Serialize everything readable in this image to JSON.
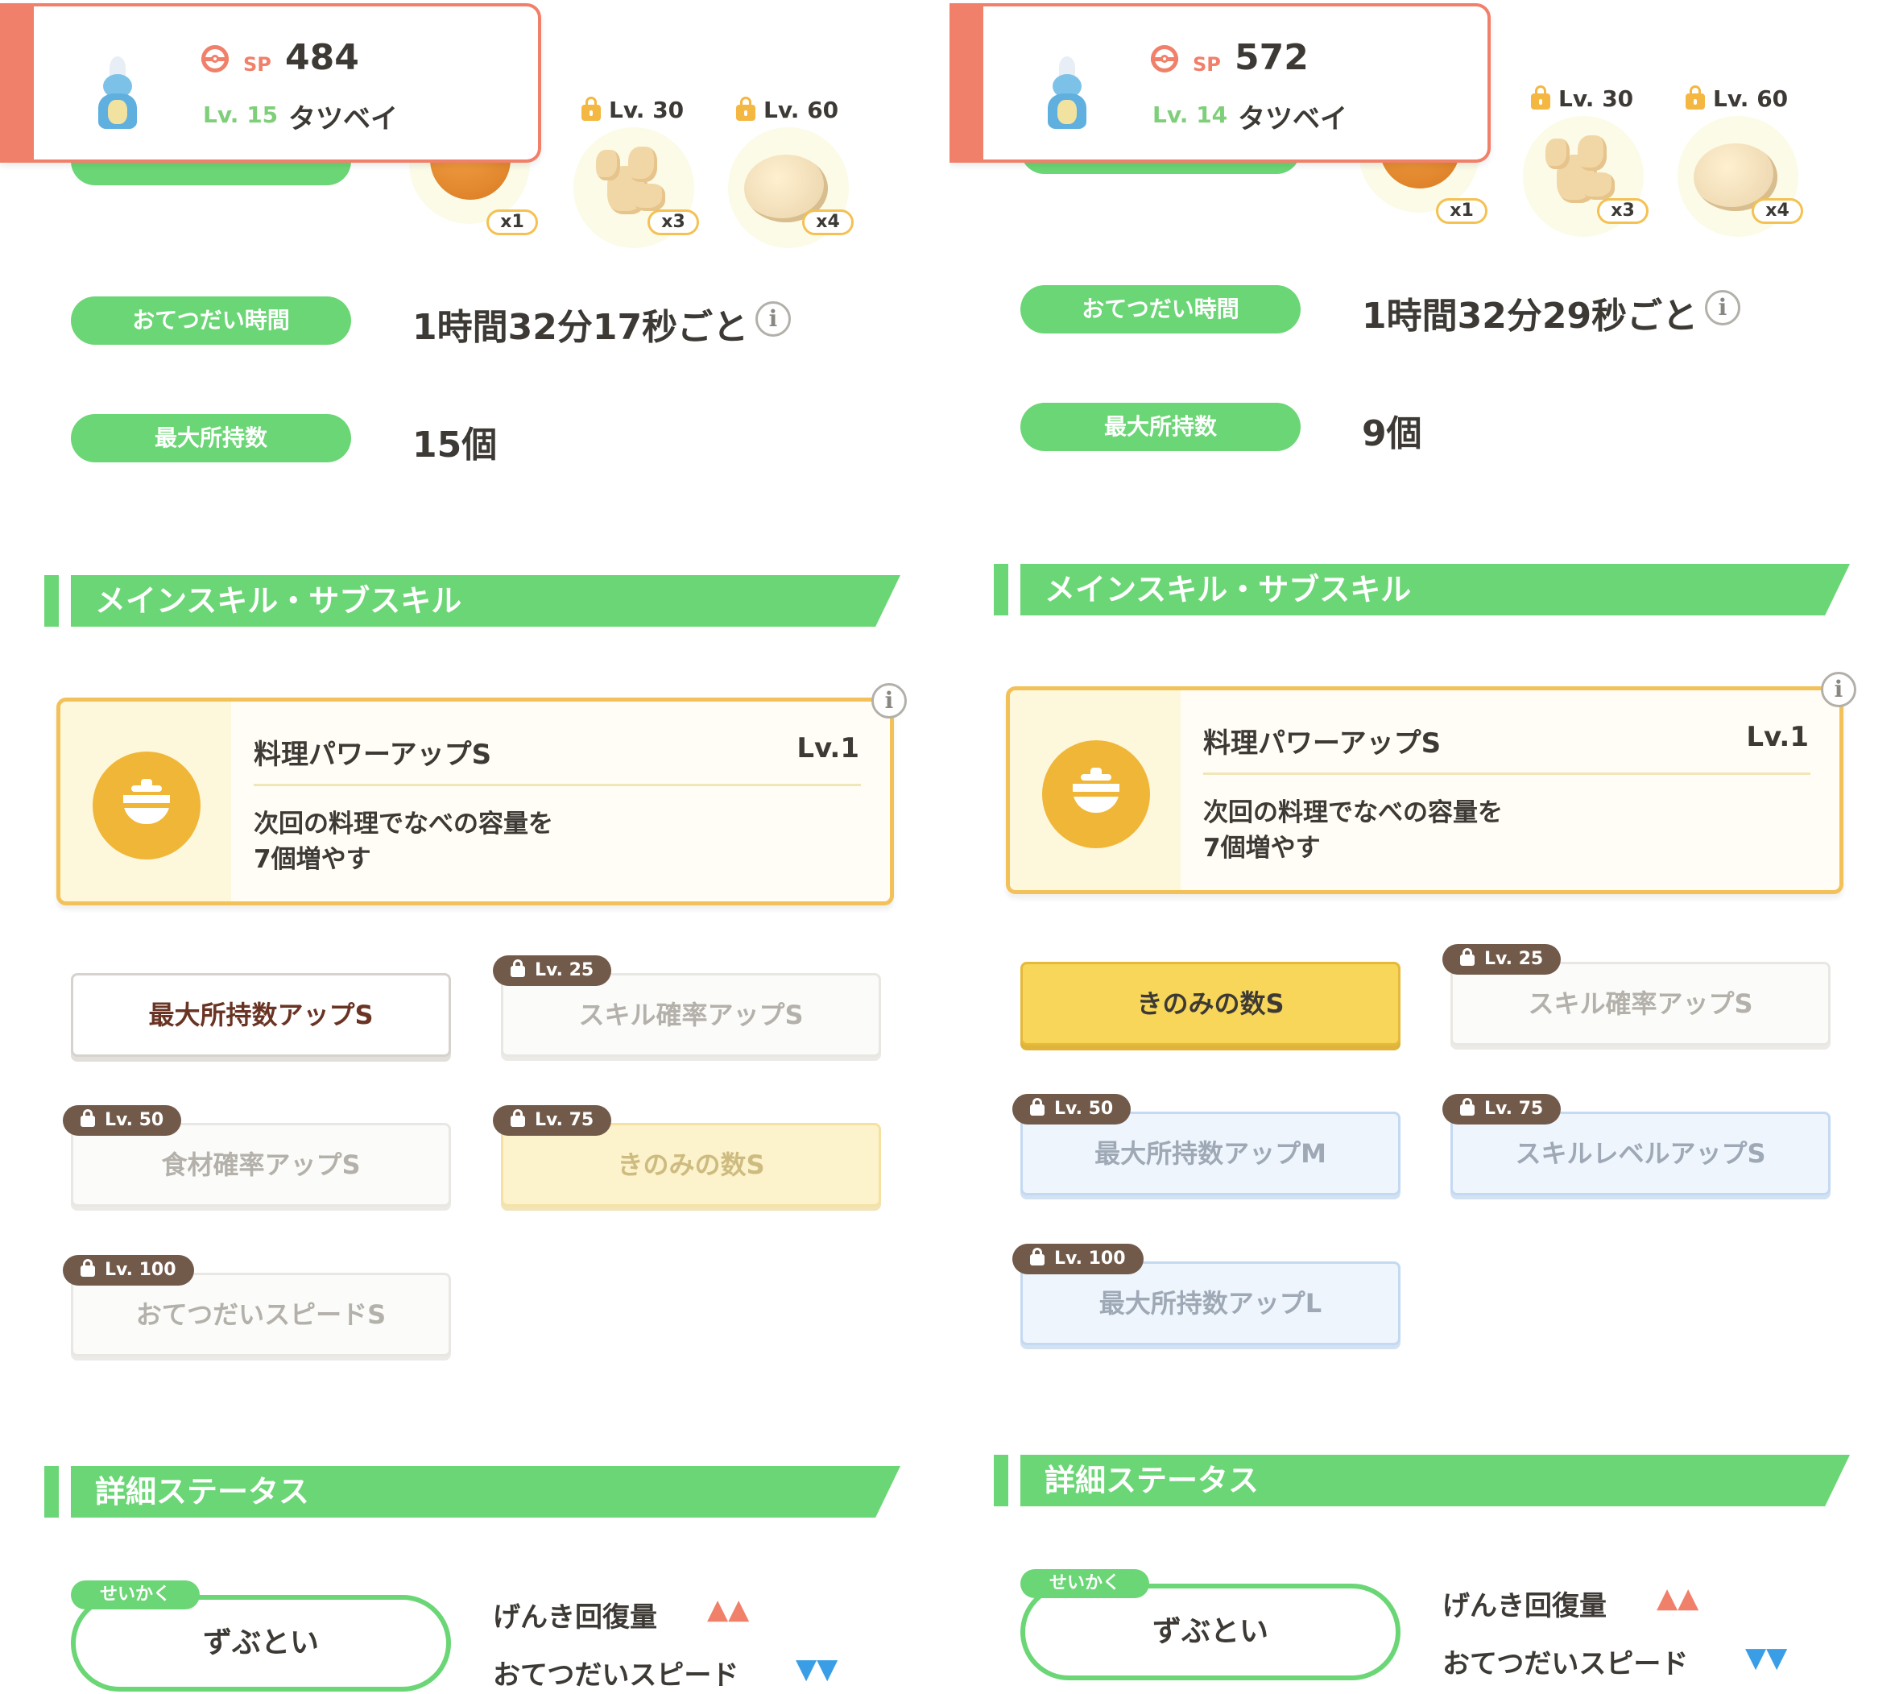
{
  "panels": [
    {
      "sp_label": "SP",
      "sp_value": "484",
      "level": "Lv. 15",
      "name": "タツベイ",
      "ingredients": [
        {
          "count": "x1",
          "level": ""
        },
        {
          "count": "x3",
          "level": "Lv. 30"
        },
        {
          "count": "x4",
          "level": "Lv. 60"
        }
      ],
      "help_time_label": "おてつだい時間",
      "help_time_value": "1時間32分17秒ごと",
      "max_carry_label": "最大所持数",
      "max_carry_value": "15個",
      "skills_header": "メインスキル・サブスキル",
      "main_skill": {
        "name": "料理パワーアップS",
        "level": "Lv.1",
        "desc_line1": "次回の料理でなべの容量を",
        "desc_line2": "7個増やす"
      },
      "sub_skills": [
        {
          "label": "最大所持数アップS",
          "lock": ""
        },
        {
          "label": "スキル確率アップS",
          "lock": "Lv. 25"
        },
        {
          "label": "食材確率アップS",
          "lock": "Lv. 50"
        },
        {
          "label": "きのみの数S",
          "lock": "Lv. 75"
        },
        {
          "label": "おてつだいスピードS",
          "lock": "Lv. 100"
        }
      ],
      "status_header": "詳細ステータス",
      "nature_tag": "せいかく",
      "nature": "ずぶとい",
      "stat_up": "げんき回復量",
      "stat_up_marks": "▲▲",
      "stat_down": "おてつだいスピード",
      "stat_down_marks": "▼▼"
    },
    {
      "sp_label": "SP",
      "sp_value": "572",
      "level": "Lv. 14",
      "name": "タツベイ",
      "ingredients": [
        {
          "count": "x1",
          "level": ""
        },
        {
          "count": "x3",
          "level": "Lv. 30"
        },
        {
          "count": "x4",
          "level": "Lv. 60"
        }
      ],
      "help_time_label": "おてつだい時間",
      "help_time_value": "1時間32分29秒ごと",
      "max_carry_label": "最大所持数",
      "max_carry_value": "9個",
      "skills_header": "メインスキル・サブスキル",
      "main_skill": {
        "name": "料理パワーアップS",
        "level": "Lv.1",
        "desc_line1": "次回の料理でなべの容量を",
        "desc_line2": "7個増やす"
      },
      "sub_skills": [
        {
          "label": "きのみの数S",
          "lock": ""
        },
        {
          "label": "スキル確率アップS",
          "lock": "Lv. 25"
        },
        {
          "label": "最大所持数アップM",
          "lock": "Lv. 50"
        },
        {
          "label": "スキルレベルアップS",
          "lock": "Lv. 75"
        },
        {
          "label": "最大所持数アップL",
          "lock": "Lv. 100"
        }
      ],
      "status_header": "詳細ステータス",
      "nature_tag": "せいかく",
      "nature": "ずぶとい",
      "stat_up": "げんき回復量",
      "stat_up_marks": "▲▲",
      "stat_down": "おてつだいスピード",
      "stat_down_marks": "▼▼"
    }
  ],
  "icons": {
    "info": "i",
    "sp": "pokeball-icon",
    "lock": "lock-icon",
    "pot": "cooking-pot-icon"
  },
  "colors": {
    "green": "#6bd675",
    "coral": "#f0806a",
    "gold": "#f3c15a",
    "blue_lock": "#c4d9f2",
    "up": "#f0806a",
    "down": "#3a9ee6"
  }
}
